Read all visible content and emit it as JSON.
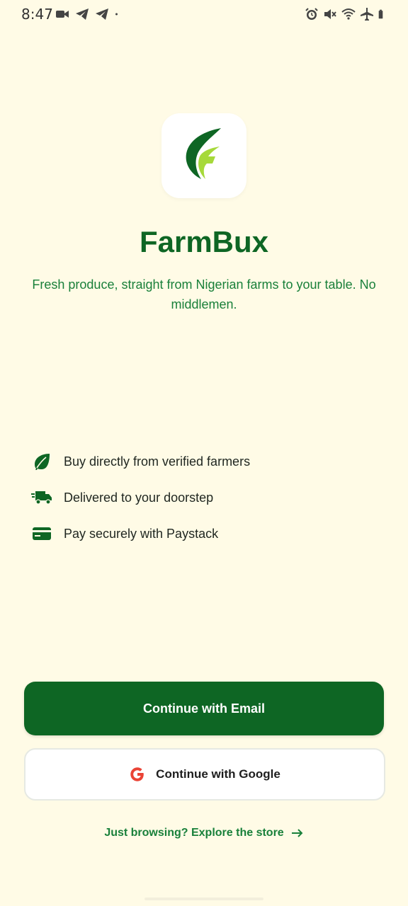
{
  "status_bar": {
    "time": "8:47",
    "left_icons": [
      "video-camera-icon",
      "telegram-icon",
      "telegram-icon",
      "dot-icon"
    ],
    "right_icons": [
      "alarm-icon",
      "mute-icon",
      "wifi-icon",
      "airplane-mode-icon",
      "battery-icon"
    ]
  },
  "app": {
    "logo_icon": "leaf-logo-icon",
    "title": "FarmBux",
    "tagline": "Fresh produce, straight from Nigerian farms to your table. No middlemen."
  },
  "features": [
    {
      "icon": "leaf-icon",
      "text": "Buy directly from verified farmers"
    },
    {
      "icon": "delivery-truck-icon",
      "text": "Delivered to your doorstep"
    },
    {
      "icon": "credit-card-icon",
      "text": "Pay securely with Paystack"
    }
  ],
  "actions": {
    "email_label": "Continue with Email",
    "google_label": "Continue with Google",
    "explore_label": "Just browsing? Explore the store"
  },
  "colors": {
    "background": "#fffbe6",
    "primary": "#0e6624",
    "accent_text": "#19803a",
    "logo_light_green": "#a6d93a",
    "google_red": "#ea4335"
  }
}
